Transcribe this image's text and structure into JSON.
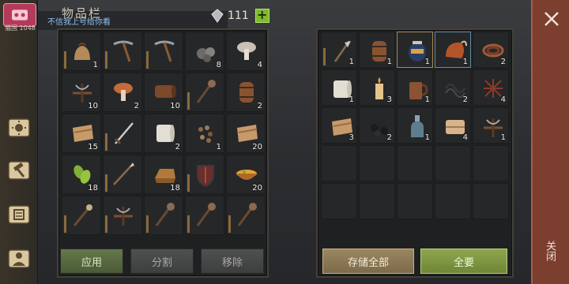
{
  "header": {
    "title": "物品栏",
    "level_text": "猫国 1048",
    "subtitle": "不信我上号给你看",
    "currency_amount": "111"
  },
  "inventory": [
    {
      "icon": "grain-sack-icon",
      "qty": "1",
      "dur": true
    },
    {
      "icon": "pickaxe-icon",
      "qty": "",
      "dur": true
    },
    {
      "icon": "pickaxe-icon",
      "qty": "",
      "dur": true
    },
    {
      "icon": "ore-icon",
      "qty": "8"
    },
    {
      "icon": "mushroom-icon",
      "qty": "4"
    },
    {
      "icon": "crossbow-icon",
      "qty": "10"
    },
    {
      "icon": "mushroom-red-icon",
      "qty": "2"
    },
    {
      "icon": "leather-roll-icon",
      "qty": "10"
    },
    {
      "icon": "mace-icon",
      "qty": "",
      "dur": true
    },
    {
      "icon": "barrel-icon",
      "qty": "2"
    },
    {
      "icon": "cloth-icon",
      "qty": "15"
    },
    {
      "icon": "sword-icon",
      "qty": "",
      "dur": true
    },
    {
      "icon": "paper-roll-icon",
      "qty": "2"
    },
    {
      "icon": "seeds-icon",
      "qty": "1"
    },
    {
      "icon": "cloth-icon",
      "qty": "20"
    },
    {
      "icon": "herb-icon",
      "qty": "18"
    },
    {
      "icon": "spear-icon",
      "qty": "",
      "dur": true
    },
    {
      "icon": "ingot-icon",
      "qty": "18"
    },
    {
      "icon": "shield-icon",
      "qty": "",
      "dur": true
    },
    {
      "icon": "soup-bowl-icon",
      "qty": "20"
    },
    {
      "icon": "torch-icon",
      "qty": "",
      "dur": true
    },
    {
      "icon": "crossbow-icon",
      "qty": "",
      "dur": true
    },
    {
      "icon": "mace-icon",
      "qty": "",
      "dur": true
    },
    {
      "icon": "mace-icon",
      "qty": "",
      "dur": true
    },
    {
      "icon": "mace-icon",
      "qty": "",
      "dur": true
    }
  ],
  "storage": [
    {
      "icon": "halberd-icon",
      "qty": "1",
      "dur": true
    },
    {
      "icon": "barrel-icon",
      "qty": "1"
    },
    {
      "icon": "honey-jar-icon",
      "qty": "1",
      "sel": true
    },
    {
      "icon": "copper-pot-icon",
      "qty": "1",
      "blue": true
    },
    {
      "icon": "rope-icon",
      "qty": "2"
    },
    {
      "icon": "paper-roll-icon",
      "qty": "1"
    },
    {
      "icon": "candle-icon",
      "qty": "3"
    },
    {
      "icon": "mug-icon",
      "qty": "1"
    },
    {
      "icon": "wire-icon",
      "qty": "2"
    },
    {
      "icon": "net-icon",
      "qty": "4"
    },
    {
      "icon": "cloth-icon",
      "qty": "3"
    },
    {
      "icon": "coal-icon",
      "qty": "2"
    },
    {
      "icon": "bottle-icon",
      "qty": "1"
    },
    {
      "icon": "cloth-bundle-icon",
      "qty": "4"
    },
    {
      "icon": "crossbow-icon",
      "qty": "1"
    },
    {
      "icon": "",
      "qty": ""
    },
    {
      "icon": "",
      "qty": ""
    },
    {
      "icon": "",
      "qty": ""
    },
    {
      "icon": "",
      "qty": ""
    },
    {
      "icon": "",
      "qty": ""
    },
    {
      "icon": "",
      "qty": ""
    },
    {
      "icon": "",
      "qty": ""
    },
    {
      "icon": "",
      "qty": ""
    },
    {
      "icon": "",
      "qty": ""
    },
    {
      "icon": "",
      "qty": ""
    }
  ],
  "buttons": {
    "apply": "应用",
    "split": "分割",
    "move": "移除",
    "store_all": "存储全部",
    "take_all": "全要"
  },
  "close_label": "关闭",
  "colors": {
    "accent_green": "#7dbb2c",
    "close_bg": "#7c3e2f"
  }
}
